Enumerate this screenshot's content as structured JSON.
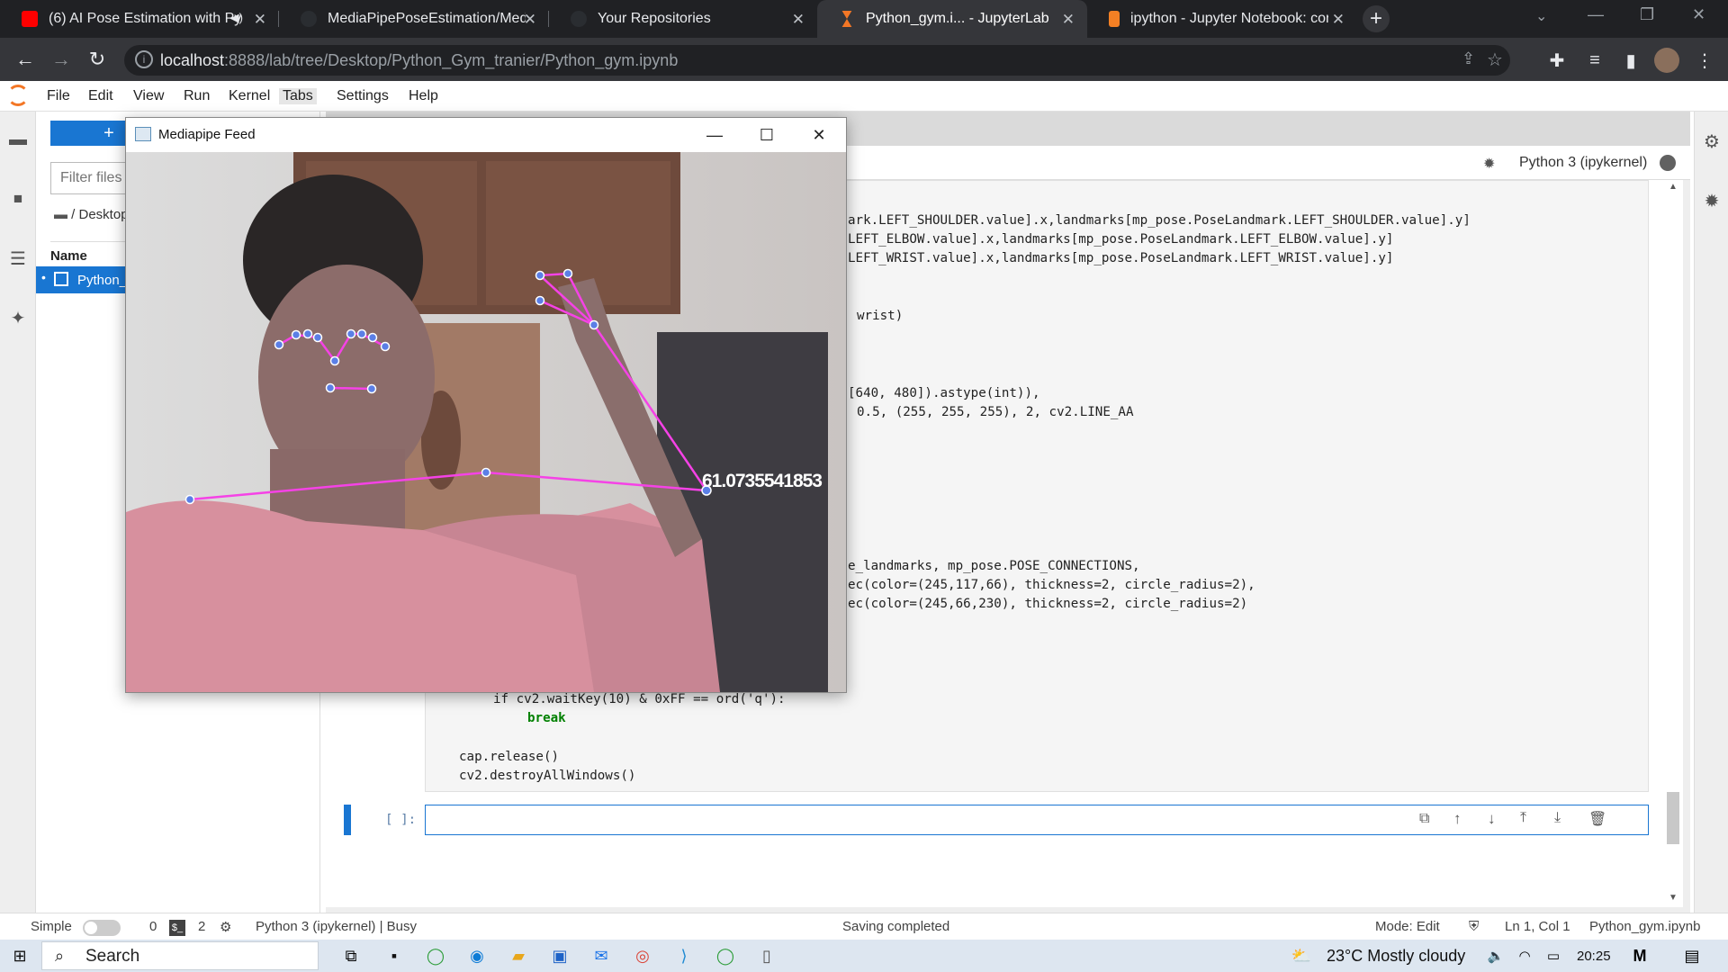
{
  "browser": {
    "tabs": [
      {
        "title": "(6) AI Pose Estimation with Py",
        "favicon_color": "#ff0000",
        "active": false
      },
      {
        "title": "MediaPipePoseEstimation/Media",
        "favicon_color": "#24292f",
        "active": false
      },
      {
        "title": "Your Repositories",
        "favicon_color": "#24292f",
        "active": false
      },
      {
        "title": "Python_gym.i... - JupyterLab",
        "favicon_color": "#f37726",
        "active": true
      },
      {
        "title": "ipython - Jupyter Notebook: com",
        "favicon_color": "#f48024",
        "active": false
      }
    ],
    "url_host": "localhost",
    "url_rest": ":8888/lab/tree/Desktop/Python_Gym_tranier/Python_gym.ipynb"
  },
  "jupyter": {
    "menu": [
      "File",
      "Edit",
      "View",
      "Run",
      "Kernel",
      "Tabs",
      "Settings",
      "Help"
    ],
    "new_button": "+",
    "filter_placeholder": "Filter files by name",
    "breadcrumb": "/ Desktop",
    "name_header": "Name",
    "file_item": "Python_gym.ipynb",
    "kernel_name": "Python 3 (ipykernel)",
    "code_lines": [
      "ark.LEFT_SHOULDER.value].x,landmarks[mp_pose.PoseLandmark.LEFT_SHOULDER.value].y]",
      "LEFT_ELBOW.value].x,landmarks[mp_pose.PoseLandmark.LEFT_ELBOW.value].y]",
      "LEFT_WRIST.value].x,landmarks[mp_pose.PoseLandmark.LEFT_WRIST.value].y]",
      "wrist)",
      "[640, 480]).astype(int)),",
      "0.5, (255, 255, 255), 2, cv2.LINE_AA",
      "e_landmarks, mp_pose.POSE_CONNECTIONS,",
      "ec(color=(245,117,66), thickness=2, circle_radius=2),",
      "ec(color=(245,66,230), thickness=2, circle_radius=2)",
      "if cv2.waitKey(10) & 0xFF == ord('q'):",
      "break",
      "cap.release()",
      "cv2.destroyAllWindows()"
    ],
    "empty_prompt": "[ ]:",
    "status": {
      "mode_label": "Simple",
      "terminals": "0",
      "kernels": "2",
      "kernel_status": "Python 3 (ipykernel) | Busy",
      "message": "Saving completed",
      "edit_mode": "Mode: Edit",
      "cursor": "Ln 1, Col 1",
      "filename": "Python_gym.ipynb"
    }
  },
  "cv_window": {
    "title": "Mediapipe Feed",
    "angle_text": "61.0735541853"
  },
  "taskbar": {
    "search_label": "Search",
    "weather": "23°C  Mostly cloudy",
    "time": "20:25"
  }
}
